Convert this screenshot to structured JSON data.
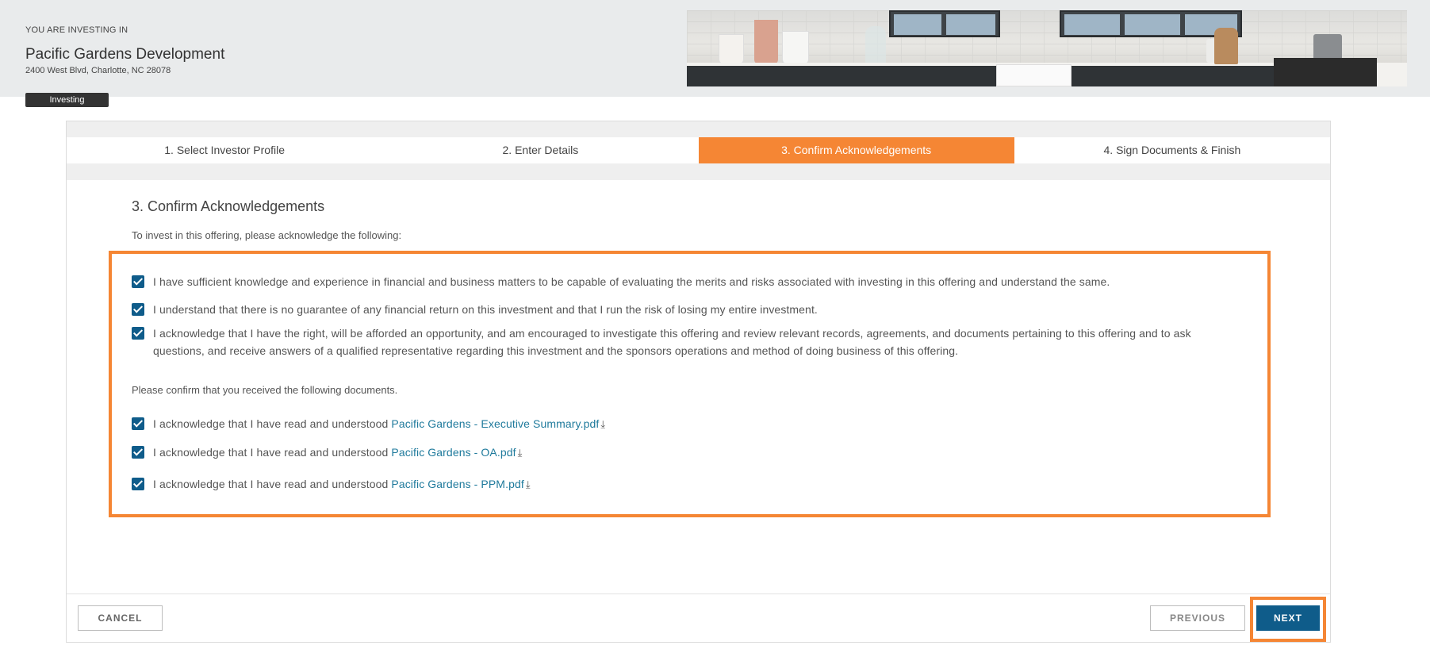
{
  "header": {
    "eyebrow": "YOU ARE INVESTING IN",
    "offering_name": "Pacific Gardens Development",
    "address": "2400 West Blvd, Charlotte, NC 28078",
    "status": "Investing"
  },
  "steps": [
    {
      "label": "1. Select Investor Profile",
      "active": false
    },
    {
      "label": "2. Enter Details",
      "active": false
    },
    {
      "label": "3. Confirm Acknowledgements",
      "active": true
    },
    {
      "label": "4. Sign Documents & Finish",
      "active": false
    }
  ],
  "section": {
    "title": "3. Confirm Acknowledgements",
    "intro": "To invest in this offering, please acknowledge the following:"
  },
  "acknowledgements": [
    {
      "text": "I have sufficient knowledge and experience in financial and business matters to be capable of evaluating the merits and risks associated with investing in this offering and understand the same.",
      "checked": true
    },
    {
      "text": "I understand that there is no guarantee of any financial return on this investment and that I run the risk of losing my entire investment.",
      "checked": true
    },
    {
      "text": "I acknowledge that I have the right, will be afforded an opportunity, and am encouraged to investigate this offering and review relevant records, agreements, and documents pertaining to this offering and to ask questions, and receive answers of a qualified representative regarding this investment and the sponsors operations and method of doing business of this offering.",
      "checked": true
    }
  ],
  "documents": {
    "intro": "Please confirm that you received the following documents.",
    "prefix": "I acknowledge that I have read and understood",
    "items": [
      {
        "name": "Pacific Gardens - Executive Summary.pdf",
        "checked": true
      },
      {
        "name": "Pacific Gardens - OA.pdf",
        "checked": true
      },
      {
        "name": "Pacific Gardens - PPM.pdf",
        "checked": true
      }
    ]
  },
  "buttons": {
    "cancel": "CANCEL",
    "previous": "PREVIOUS",
    "next": "NEXT"
  },
  "colors": {
    "accent": "#f58634",
    "primary": "#0f5c8a",
    "link": "#1f7a9c"
  },
  "icons": {
    "download": "download-icon",
    "checkbox": "checkbox-checked-icon"
  }
}
